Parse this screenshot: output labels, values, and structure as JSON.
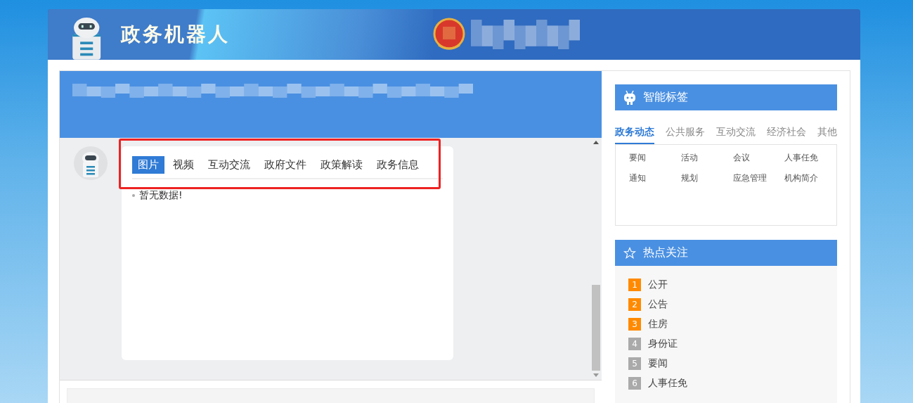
{
  "header": {
    "title": "政务机器人"
  },
  "chat": {
    "tabs": [
      {
        "label": "图片",
        "selected": true
      },
      {
        "label": "视频",
        "selected": false
      },
      {
        "label": "互动交流",
        "selected": false
      },
      {
        "label": "政府文件",
        "selected": false
      },
      {
        "label": "政策解读",
        "selected": false
      },
      {
        "label": "政务信息",
        "selected": false
      }
    ],
    "empty_message": "暂无数据!"
  },
  "smart_tags": {
    "title": "智能标签",
    "tabs": [
      {
        "label": "政务动态",
        "selected": true
      },
      {
        "label": "公共服务",
        "selected": false
      },
      {
        "label": "互动交流",
        "selected": false
      },
      {
        "label": "经济社会",
        "selected": false
      },
      {
        "label": "其他",
        "selected": false
      }
    ],
    "items": [
      "要闻",
      "活动",
      "会议",
      "人事任免",
      "通知",
      "规划",
      "应急管理",
      "机构简介"
    ]
  },
  "hot_topics": {
    "title": "热点关注",
    "items": [
      {
        "rank": "1",
        "label": "公开",
        "color": "#ff8a00"
      },
      {
        "rank": "2",
        "label": "公告",
        "color": "#ff8a00"
      },
      {
        "rank": "3",
        "label": "住房",
        "color": "#ff8a00"
      },
      {
        "rank": "4",
        "label": "身份证",
        "color": "#aaaaaa"
      },
      {
        "rank": "5",
        "label": "要闻",
        "color": "#aaaaaa"
      },
      {
        "rank": "6",
        "label": "人事任免",
        "color": "#aaaaaa"
      }
    ]
  }
}
